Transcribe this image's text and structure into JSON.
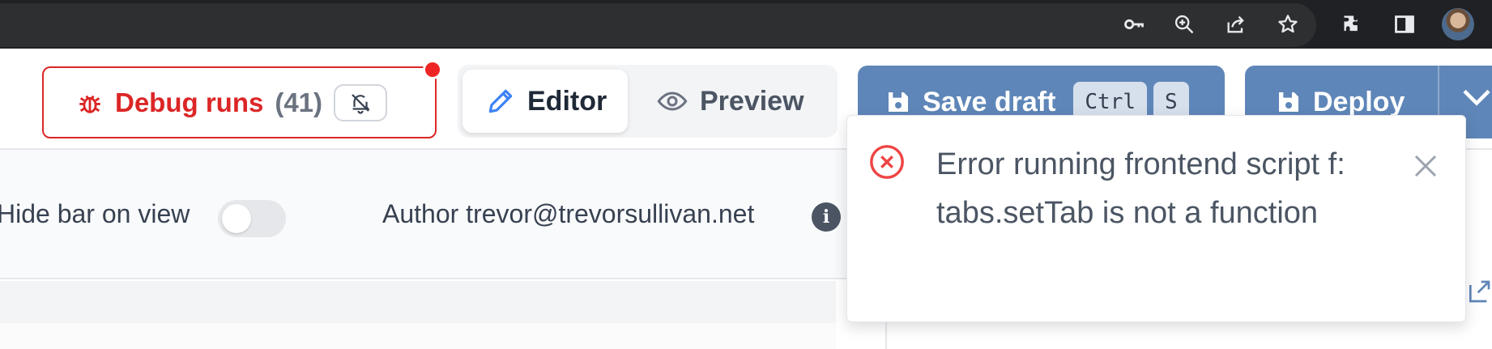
{
  "browser": {
    "icons": [
      "key-icon",
      "zoom-icon",
      "share-icon",
      "star-icon",
      "extensions-icon",
      "sidepanel-icon",
      "avatar"
    ]
  },
  "header": {
    "debug_label": "Debug runs",
    "debug_count": "(41)",
    "tabs": [
      {
        "label": "Editor",
        "icon": "pencil-icon"
      },
      {
        "label": "Preview",
        "icon": "eye-icon"
      }
    ],
    "save_label": "Save draft",
    "shortcut_keys": [
      "Ctrl",
      "S"
    ],
    "deploy_label": "Deploy"
  },
  "settings": {
    "hide_bar_label": "Hide bar on view",
    "hide_bar_enabled": false,
    "author_text": "Author trevor@trevorsullivan.net",
    "info_glyph": "i"
  },
  "toast": {
    "message": "Error running frontend script f: tabs.setTab is not a function",
    "type": "error"
  },
  "colors": {
    "accent_red": "#dc2626",
    "primary_button": "#5f86b8",
    "browser_chrome": "#202124"
  }
}
